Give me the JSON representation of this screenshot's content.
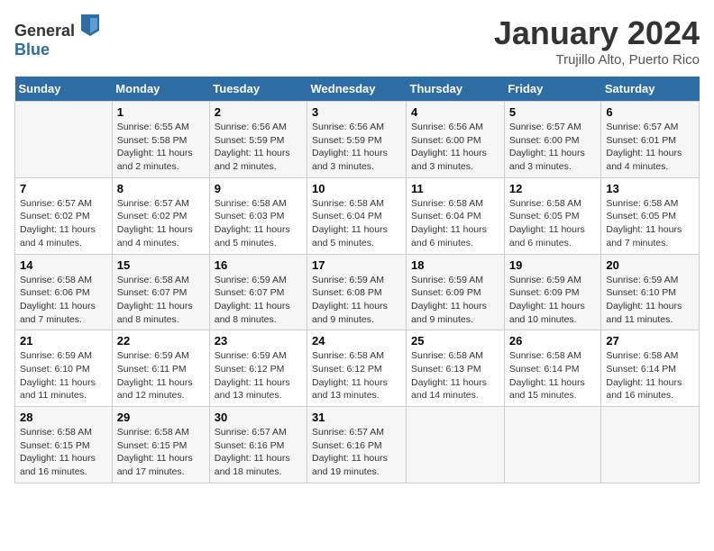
{
  "header": {
    "logo_general": "General",
    "logo_blue": "Blue",
    "title": "January 2024",
    "subtitle": "Trujillo Alto, Puerto Rico"
  },
  "columns": [
    "Sunday",
    "Monday",
    "Tuesday",
    "Wednesday",
    "Thursday",
    "Friday",
    "Saturday"
  ],
  "weeks": [
    [
      {
        "day": "",
        "detail": ""
      },
      {
        "day": "1",
        "detail": "Sunrise: 6:55 AM\nSunset: 5:58 PM\nDaylight: 11 hours\nand 2 minutes."
      },
      {
        "day": "2",
        "detail": "Sunrise: 6:56 AM\nSunset: 5:59 PM\nDaylight: 11 hours\nand 2 minutes."
      },
      {
        "day": "3",
        "detail": "Sunrise: 6:56 AM\nSunset: 5:59 PM\nDaylight: 11 hours\nand 3 minutes."
      },
      {
        "day": "4",
        "detail": "Sunrise: 6:56 AM\nSunset: 6:00 PM\nDaylight: 11 hours\nand 3 minutes."
      },
      {
        "day": "5",
        "detail": "Sunrise: 6:57 AM\nSunset: 6:00 PM\nDaylight: 11 hours\nand 3 minutes."
      },
      {
        "day": "6",
        "detail": "Sunrise: 6:57 AM\nSunset: 6:01 PM\nDaylight: 11 hours\nand 4 minutes."
      }
    ],
    [
      {
        "day": "7",
        "detail": "Sunrise: 6:57 AM\nSunset: 6:02 PM\nDaylight: 11 hours\nand 4 minutes."
      },
      {
        "day": "8",
        "detail": "Sunrise: 6:57 AM\nSunset: 6:02 PM\nDaylight: 11 hours\nand 4 minutes."
      },
      {
        "day": "9",
        "detail": "Sunrise: 6:58 AM\nSunset: 6:03 PM\nDaylight: 11 hours\nand 5 minutes."
      },
      {
        "day": "10",
        "detail": "Sunrise: 6:58 AM\nSunset: 6:04 PM\nDaylight: 11 hours\nand 5 minutes."
      },
      {
        "day": "11",
        "detail": "Sunrise: 6:58 AM\nSunset: 6:04 PM\nDaylight: 11 hours\nand 6 minutes."
      },
      {
        "day": "12",
        "detail": "Sunrise: 6:58 AM\nSunset: 6:05 PM\nDaylight: 11 hours\nand 6 minutes."
      },
      {
        "day": "13",
        "detail": "Sunrise: 6:58 AM\nSunset: 6:05 PM\nDaylight: 11 hours\nand 7 minutes."
      }
    ],
    [
      {
        "day": "14",
        "detail": "Sunrise: 6:58 AM\nSunset: 6:06 PM\nDaylight: 11 hours\nand 7 minutes."
      },
      {
        "day": "15",
        "detail": "Sunrise: 6:58 AM\nSunset: 6:07 PM\nDaylight: 11 hours\nand 8 minutes."
      },
      {
        "day": "16",
        "detail": "Sunrise: 6:59 AM\nSunset: 6:07 PM\nDaylight: 11 hours\nand 8 minutes."
      },
      {
        "day": "17",
        "detail": "Sunrise: 6:59 AM\nSunset: 6:08 PM\nDaylight: 11 hours\nand 9 minutes."
      },
      {
        "day": "18",
        "detail": "Sunrise: 6:59 AM\nSunset: 6:09 PM\nDaylight: 11 hours\nand 9 minutes."
      },
      {
        "day": "19",
        "detail": "Sunrise: 6:59 AM\nSunset: 6:09 PM\nDaylight: 11 hours\nand 10 minutes."
      },
      {
        "day": "20",
        "detail": "Sunrise: 6:59 AM\nSunset: 6:10 PM\nDaylight: 11 hours\nand 11 minutes."
      }
    ],
    [
      {
        "day": "21",
        "detail": "Sunrise: 6:59 AM\nSunset: 6:10 PM\nDaylight: 11 hours\nand 11 minutes."
      },
      {
        "day": "22",
        "detail": "Sunrise: 6:59 AM\nSunset: 6:11 PM\nDaylight: 11 hours\nand 12 minutes."
      },
      {
        "day": "23",
        "detail": "Sunrise: 6:59 AM\nSunset: 6:12 PM\nDaylight: 11 hours\nand 13 minutes."
      },
      {
        "day": "24",
        "detail": "Sunrise: 6:58 AM\nSunset: 6:12 PM\nDaylight: 11 hours\nand 13 minutes."
      },
      {
        "day": "25",
        "detail": "Sunrise: 6:58 AM\nSunset: 6:13 PM\nDaylight: 11 hours\nand 14 minutes."
      },
      {
        "day": "26",
        "detail": "Sunrise: 6:58 AM\nSunset: 6:14 PM\nDaylight: 11 hours\nand 15 minutes."
      },
      {
        "day": "27",
        "detail": "Sunrise: 6:58 AM\nSunset: 6:14 PM\nDaylight: 11 hours\nand 16 minutes."
      }
    ],
    [
      {
        "day": "28",
        "detail": "Sunrise: 6:58 AM\nSunset: 6:15 PM\nDaylight: 11 hours\nand 16 minutes."
      },
      {
        "day": "29",
        "detail": "Sunrise: 6:58 AM\nSunset: 6:15 PM\nDaylight: 11 hours\nand 17 minutes."
      },
      {
        "day": "30",
        "detail": "Sunrise: 6:57 AM\nSunset: 6:16 PM\nDaylight: 11 hours\nand 18 minutes."
      },
      {
        "day": "31",
        "detail": "Sunrise: 6:57 AM\nSunset: 6:16 PM\nDaylight: 11 hours\nand 19 minutes."
      },
      {
        "day": "",
        "detail": ""
      },
      {
        "day": "",
        "detail": ""
      },
      {
        "day": "",
        "detail": ""
      }
    ]
  ]
}
